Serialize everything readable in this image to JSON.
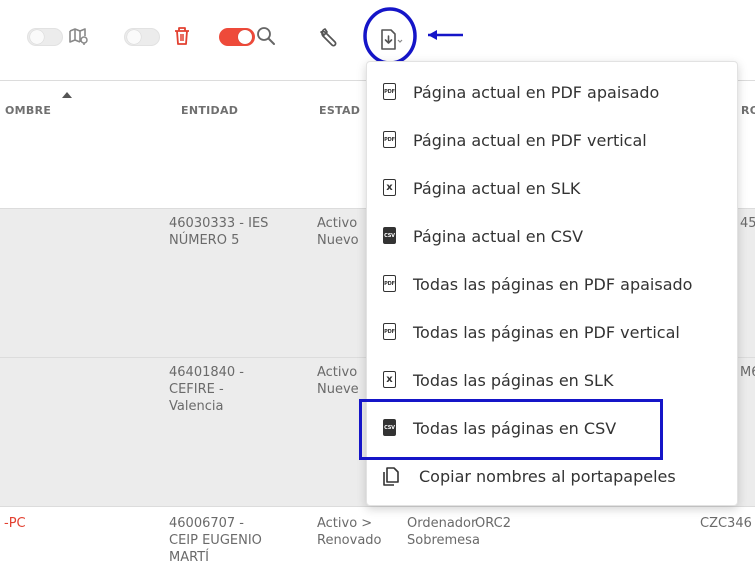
{
  "colors": {
    "accent_red": "#ee4a3a",
    "annotation_blue": "#1515c8",
    "row_gray": "#ececec"
  },
  "toolbar": {
    "toggle_map": {
      "state": "off",
      "icon": "map-icon"
    },
    "toggle_delete": {
      "state": "off",
      "icon": "trash-icon"
    },
    "toggle_search": {
      "state": "on",
      "icon": "search-icon"
    },
    "tools_icon": "wrench-icon",
    "export_icon": "file-download-icon"
  },
  "table": {
    "headers": {
      "nombre": "OMBRE",
      "entidad": "ENTIDAD",
      "estado": "ESTAD",
      "right": "RO"
    },
    "rows": [
      {
        "entidad_line1": "46030333 - IES",
        "entidad_line2": "NÚMERO 5",
        "estado_line1": "Activo",
        "estado_line2": "Nuevo",
        "right": "45"
      },
      {
        "entidad_line1": "46401840 -",
        "entidad_line2": "CEFIRE -",
        "entidad_line3": "Valencia",
        "estado_line1": "Activo",
        "estado_line2": "Nueve",
        "right": "M6"
      },
      {
        "nombre": "-PC",
        "entidad_line1": "46006707 -",
        "entidad_line2": "CEIP EUGENIO",
        "entidad_line3": "MARTÍ",
        "estado_line1": "Activo >",
        "estado_line2": "Renovado",
        "tipo_line1": "Ordenador",
        "tipo_line2": "Sobremesa",
        "modelo": "ORC2",
        "right": "CZC346"
      }
    ]
  },
  "export_menu": {
    "items": [
      {
        "label": "Página actual en PDF apaisado",
        "icon": "pdf-icon",
        "icon_text": "PDF"
      },
      {
        "label": "Página actual en PDF vertical",
        "icon": "pdf-icon",
        "icon_text": "PDF"
      },
      {
        "label": "Página actual en SLK",
        "icon": "slk-icon",
        "icon_text": "x"
      },
      {
        "label": "Página actual en CSV",
        "icon": "csv-icon",
        "icon_text": "CSV"
      },
      {
        "label": "Todas las páginas en PDF apaisado",
        "icon": "pdf-icon",
        "icon_text": "PDF"
      },
      {
        "label": "Todas las páginas en PDF vertical",
        "icon": "pdf-icon",
        "icon_text": "PDF"
      },
      {
        "label": "Todas las páginas en SLK",
        "icon": "slk-icon",
        "icon_text": "x"
      },
      {
        "label": "Todas las páginas en CSV",
        "icon": "csv-icon",
        "icon_text": "CSV"
      },
      {
        "label": "Copiar nombres al portapapeles",
        "icon": "copy-icon"
      }
    ]
  }
}
